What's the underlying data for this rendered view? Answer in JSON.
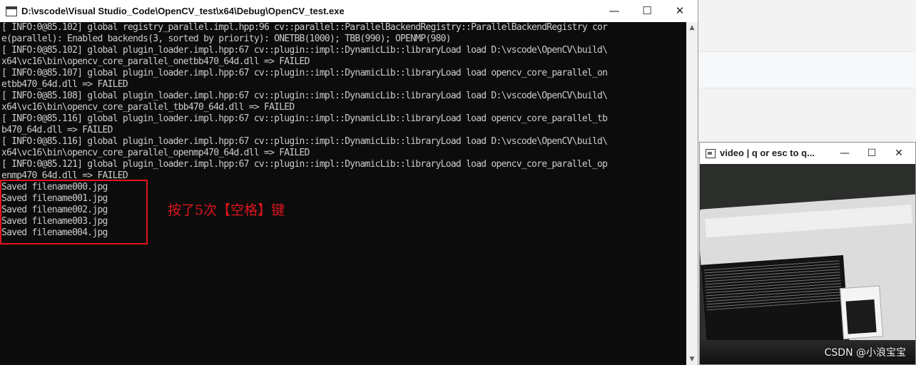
{
  "console_window": {
    "title": "D:\\vscode\\Visual Studio_Code\\OpenCV_test\\x64\\Debug\\OpenCV_test.exe",
    "controls": {
      "minimize": "—",
      "maximize": "☐",
      "close": "✕"
    },
    "lines": [
      "[ INFO:0@85.102] global registry_parallel.impl.hpp:96 cv::parallel::ParallelBackendRegistry::ParallelBackendRegistry cor",
      "e(parallel): Enabled backends(3, sorted by priority): ONETBB(1000); TBB(990); OPENMP(980)",
      "[ INFO:0@85.102] global plugin_loader.impl.hpp:67 cv::plugin::impl::DynamicLib::libraryLoad load D:\\vscode\\OpenCV\\build\\",
      "x64\\vc16\\bin\\opencv_core_parallel_onetbb470_64d.dll => FAILED",
      "[ INFO:0@85.107] global plugin_loader.impl.hpp:67 cv::plugin::impl::DynamicLib::libraryLoad load opencv_core_parallel_on",
      "etbb470_64d.dll => FAILED",
      "[ INFO:0@85.108] global plugin_loader.impl.hpp:67 cv::plugin::impl::DynamicLib::libraryLoad load D:\\vscode\\OpenCV\\build\\",
      "x64\\vc16\\bin\\opencv_core_parallel_tbb470_64d.dll => FAILED",
      "[ INFO:0@85.116] global plugin_loader.impl.hpp:67 cv::plugin::impl::DynamicLib::libraryLoad load opencv_core_parallel_tb",
      "b470_64d.dll => FAILED",
      "[ INFO:0@85.116] global plugin_loader.impl.hpp:67 cv::plugin::impl::DynamicLib::libraryLoad load D:\\vscode\\OpenCV\\build\\",
      "x64\\vc16\\bin\\opencv_core_parallel_openmp470_64d.dll => FAILED",
      "[ INFO:0@85.121] global plugin_loader.impl.hpp:67 cv::plugin::impl::DynamicLib::libraryLoad load opencv_core_parallel_op",
      "enmp470_64d.dll => FAILED",
      "Saved filename000.jpg",
      "Saved filename001.jpg",
      "Saved filename002.jpg",
      "Saved filename003.jpg",
      "Saved filename004.jpg"
    ],
    "annotation": "按了5次【空格】键"
  },
  "scrollbar": {
    "up": "▲",
    "down": "▼"
  },
  "video_window": {
    "title": "video | q or esc to q...",
    "controls": {
      "minimize": "—",
      "maximize": "☐",
      "close": "✕"
    }
  },
  "watermark": "CSDN @小浪宝宝",
  "colors": {
    "console_bg": "#0c0c0c",
    "console_text": "#cccccc",
    "annotation": "#e0141e"
  }
}
